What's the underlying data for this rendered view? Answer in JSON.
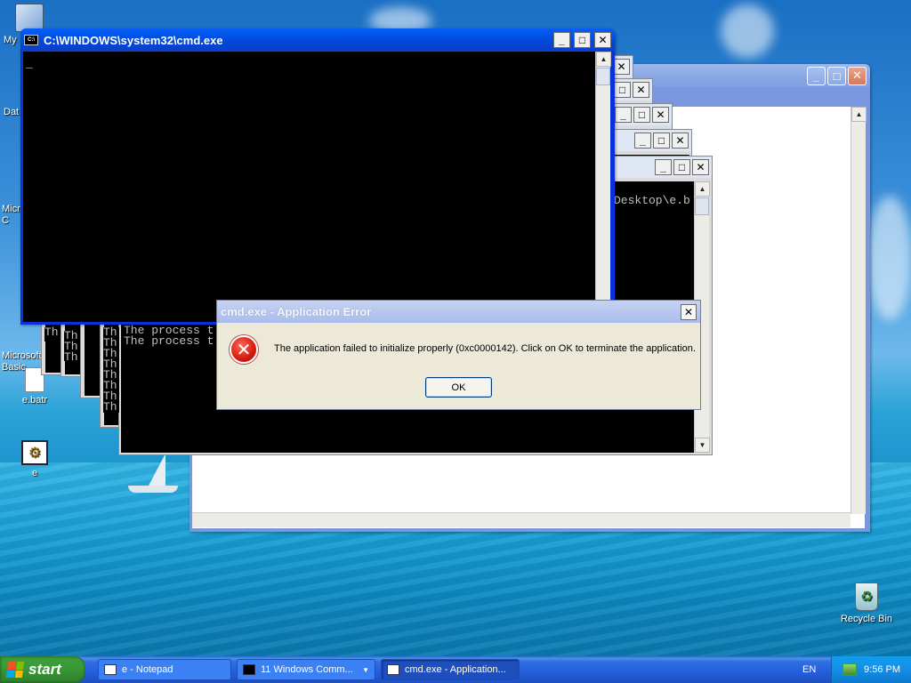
{
  "desktop": {
    "icons": [
      {
        "label": "My",
        "name": "my-computer"
      },
      {
        "label": "Dat",
        "name": "data"
      },
      {
        "label": "Micro\nC",
        "name": "microsoft-c"
      },
      {
        "label": "Microsoft\nBasic",
        "name": "microsoft-basic"
      },
      {
        "label": "e.batr",
        "name": "e-batr"
      },
      {
        "label": "e",
        "name": "e"
      },
      {
        "label": "Recycle Bin",
        "name": "recycle-bin"
      }
    ]
  },
  "cmd_main": {
    "title": "C:\\WINDOWS\\system32\\cmd.exe",
    "cursor": "_"
  },
  "cmd_back": {
    "line1": "The process t",
    "line2": "The process t",
    "side_text": "Desktop\\e.b",
    "stack_letters": "Th"
  },
  "dialog": {
    "title": "cmd.exe - Application Error",
    "message": "The application failed to initialize properly (0xc0000142). Click on OK to terminate the application.",
    "ok_label": "OK",
    "close_label": "✕"
  },
  "taskbar": {
    "start_label": "start",
    "items": [
      {
        "label": "e - Notepad"
      },
      {
        "label": "11 Windows Comm..."
      },
      {
        "label": "cmd.exe - Application..."
      }
    ],
    "language": "EN",
    "clock": "9:56 PM"
  },
  "colors": {
    "xp_blue": "#0a5cf6",
    "console_bg": "#000000",
    "dialog_bg": "#ece9d8",
    "start_green": "#3a9b37"
  }
}
